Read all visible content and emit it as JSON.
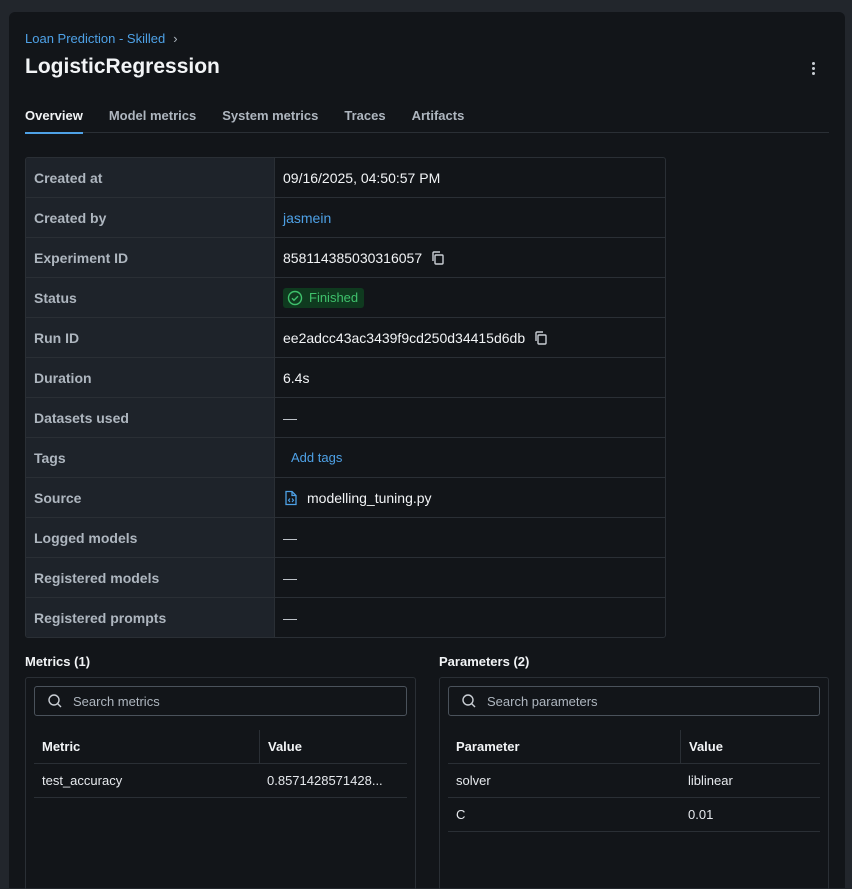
{
  "breadcrumb": {
    "experiment": "Loan Prediction - Skilled",
    "chevron": "›"
  },
  "title": "LogisticRegression",
  "tabs": [
    "Overview",
    "Model metrics",
    "System metrics",
    "Traces",
    "Artifacts"
  ],
  "details": {
    "created_at": {
      "label": "Created at",
      "value": "09/16/2025, 04:50:57 PM"
    },
    "created_by": {
      "label": "Created by",
      "value": "jasmein"
    },
    "experiment_id": {
      "label": "Experiment ID",
      "value": "858114385030316057"
    },
    "status": {
      "label": "Status",
      "value": "Finished"
    },
    "run_id": {
      "label": "Run ID",
      "value": "ee2adcc43ac3439f9cd250d34415d6db"
    },
    "duration": {
      "label": "Duration",
      "value": "6.4s"
    },
    "datasets_used": {
      "label": "Datasets used",
      "value": "—"
    },
    "tags": {
      "label": "Tags",
      "value": "Add tags"
    },
    "source": {
      "label": "Source",
      "value": "modelling_tuning.py"
    },
    "logged_models": {
      "label": "Logged models",
      "value": "—"
    },
    "registered_models": {
      "label": "Registered models",
      "value": "—"
    },
    "registered_prompts": {
      "label": "Registered prompts",
      "value": "—"
    }
  },
  "metrics": {
    "title": "Metrics (1)",
    "search_placeholder": "Search metrics",
    "columns": [
      "Metric",
      "Value"
    ],
    "rows": [
      {
        "name": "test_accuracy",
        "value": "0.8571428571428..."
      }
    ]
  },
  "parameters": {
    "title": "Parameters (2)",
    "search_placeholder": "Search parameters",
    "columns": [
      "Parameter",
      "Value"
    ],
    "rows": [
      {
        "name": "solver",
        "value": "liblinear"
      },
      {
        "name": "C",
        "value": "0.01"
      }
    ]
  },
  "colors": {
    "accent": "#4ea1e6",
    "success": "#3fc16c",
    "success_bg": "#0f3a1f"
  }
}
